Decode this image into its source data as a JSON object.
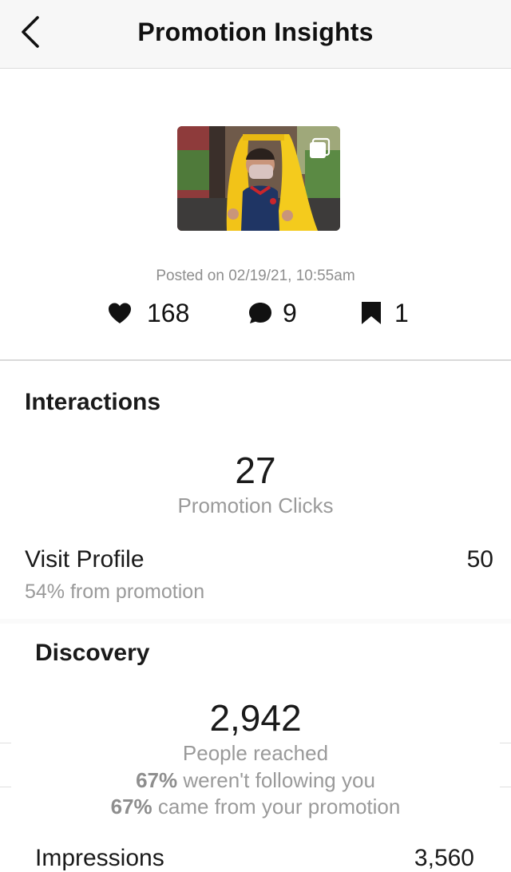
{
  "header": {
    "title": "Promotion Insights",
    "back_icon": "chevron-left-icon"
  },
  "post": {
    "posted_text": "Posted on 02/19/21, 10:55am",
    "likes": "168",
    "comments": "9",
    "saves": "1",
    "icons": {
      "likes": "heart-icon",
      "comments": "comment-bubble-icon",
      "saves": "bookmark-icon",
      "thumbnail_badge": "carousel-multiple-icon"
    }
  },
  "interactions": {
    "title": "Interactions",
    "promotion_clicks_value": "27",
    "promotion_clicks_label": "Promotion Clicks",
    "visit_profile_label": "Visit Profile",
    "visit_profile_value": "50",
    "visit_profile_sub": "54% from promotion"
  },
  "discovery": {
    "title": "Discovery",
    "people_reached_value": "2,942",
    "people_reached_label": "People reached",
    "not_following_pct": "67%",
    "not_following_text": " weren't following you",
    "from_promotion_pct": "67%",
    "from_promotion_text": " came from your promotion",
    "impressions_label": "Impressions",
    "impressions_value": "3,560"
  },
  "colors": {
    "header_bg": "#f7f7f7",
    "text_primary": "#111111",
    "text_secondary": "#9a9a9a",
    "divider": "#d9d9d9"
  }
}
